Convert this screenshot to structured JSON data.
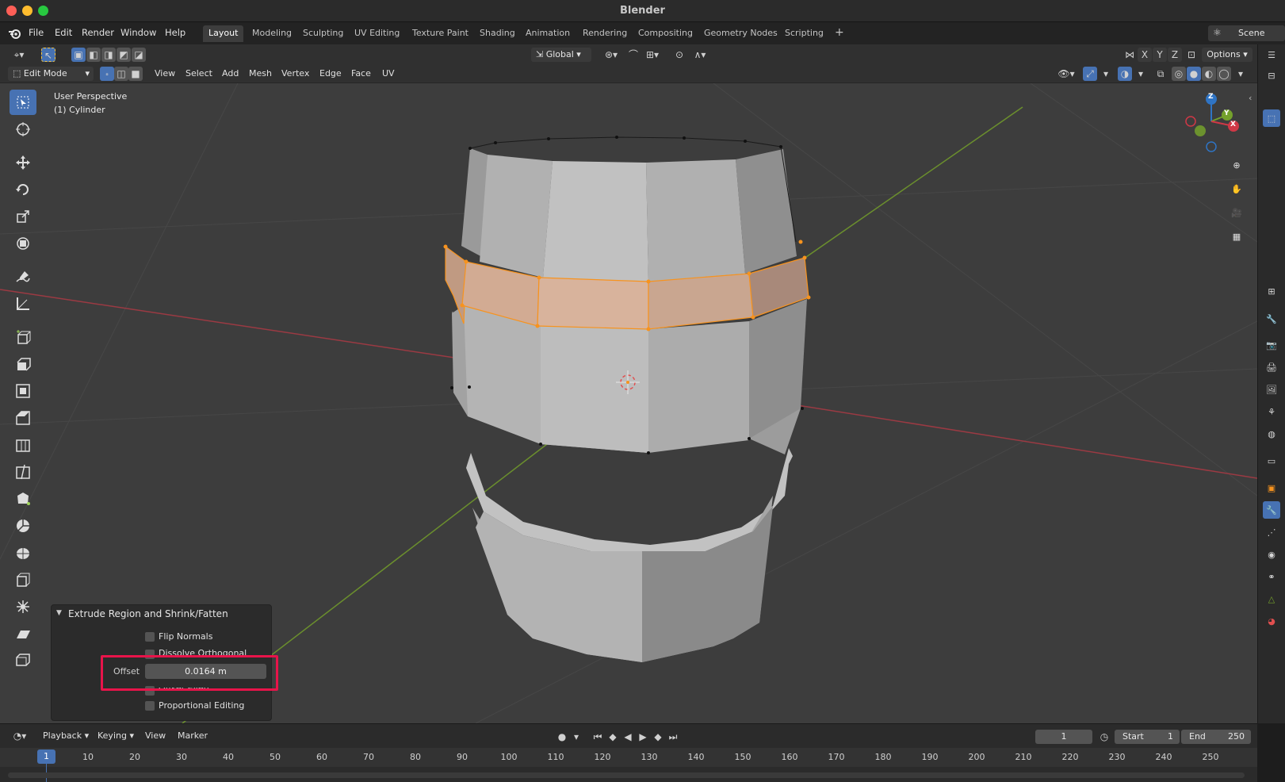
{
  "window": {
    "title": "Blender"
  },
  "colors": {
    "accent": "#4772b3",
    "selection_orange": "#f7931e",
    "highlight_box": "#e8144a",
    "axis_x": "#d03846",
    "axis_y": "#74a12c",
    "axis_z": "#2f74c4"
  },
  "menu": [
    "File",
    "Edit",
    "Render",
    "Window",
    "Help"
  ],
  "workspaces": [
    {
      "label": "Layout",
      "active": true
    },
    {
      "label": "Modeling"
    },
    {
      "label": "Sculpting"
    },
    {
      "label": "UV Editing"
    },
    {
      "label": "Texture Paint"
    },
    {
      "label": "Shading"
    },
    {
      "label": "Animation"
    },
    {
      "label": "Rendering"
    },
    {
      "label": "Compositing"
    },
    {
      "label": "Geometry Nodes"
    },
    {
      "label": "Scripting"
    }
  ],
  "scene": {
    "name": "Scene"
  },
  "header": {
    "orientation": "Global",
    "options": "Options",
    "axes": [
      "X",
      "Y",
      "Z"
    ]
  },
  "editmode": {
    "mode": "Edit Mode",
    "menus": [
      "View",
      "Select",
      "Add",
      "Mesh",
      "Vertex",
      "Edge",
      "Face",
      "UV"
    ]
  },
  "viewport": {
    "perspective": "User Perspective",
    "object": "(1) Cylinder"
  },
  "gizmo": {
    "x": "X",
    "y": "Y",
    "z": "Z"
  },
  "toolbar_icons": [
    "select-box-icon",
    "cursor-icon",
    "move-icon",
    "rotate-icon",
    "scale-icon",
    "transform-icon",
    "annotate-icon",
    "measure-icon",
    "add-cube-icon",
    "extrude-region-icon",
    "inset-faces-icon",
    "bevel-icon",
    "loop-cut-icon",
    "knife-icon",
    "poly-build-icon",
    "spin-icon",
    "smooth-icon",
    "edge-slide-icon",
    "shrink-fatten-icon",
    "shear-icon",
    "rip-region-icon"
  ],
  "operator": {
    "title": "Extrude Region and Shrink/Fatten",
    "flip_normals": "Flip Normals",
    "dissolve": "Dissolve Orthogonal Edges",
    "offset_label": "Offset",
    "offset_value": "0.0164 m",
    "offset_even": "Offset Even",
    "proportional": "Proportional Editing"
  },
  "timeline": {
    "menus": [
      "Playback",
      "Keying",
      "View",
      "Marker"
    ],
    "current_frame": "1",
    "start_label": "Start",
    "start": "1",
    "end_label": "End",
    "end": "250",
    "playhead": "1",
    "ticks": [
      "10",
      "20",
      "30",
      "40",
      "50",
      "60",
      "70",
      "80",
      "90",
      "100",
      "110",
      "120",
      "130",
      "140",
      "150",
      "160",
      "170",
      "180",
      "190",
      "200",
      "210",
      "220",
      "230",
      "240",
      "250"
    ]
  }
}
